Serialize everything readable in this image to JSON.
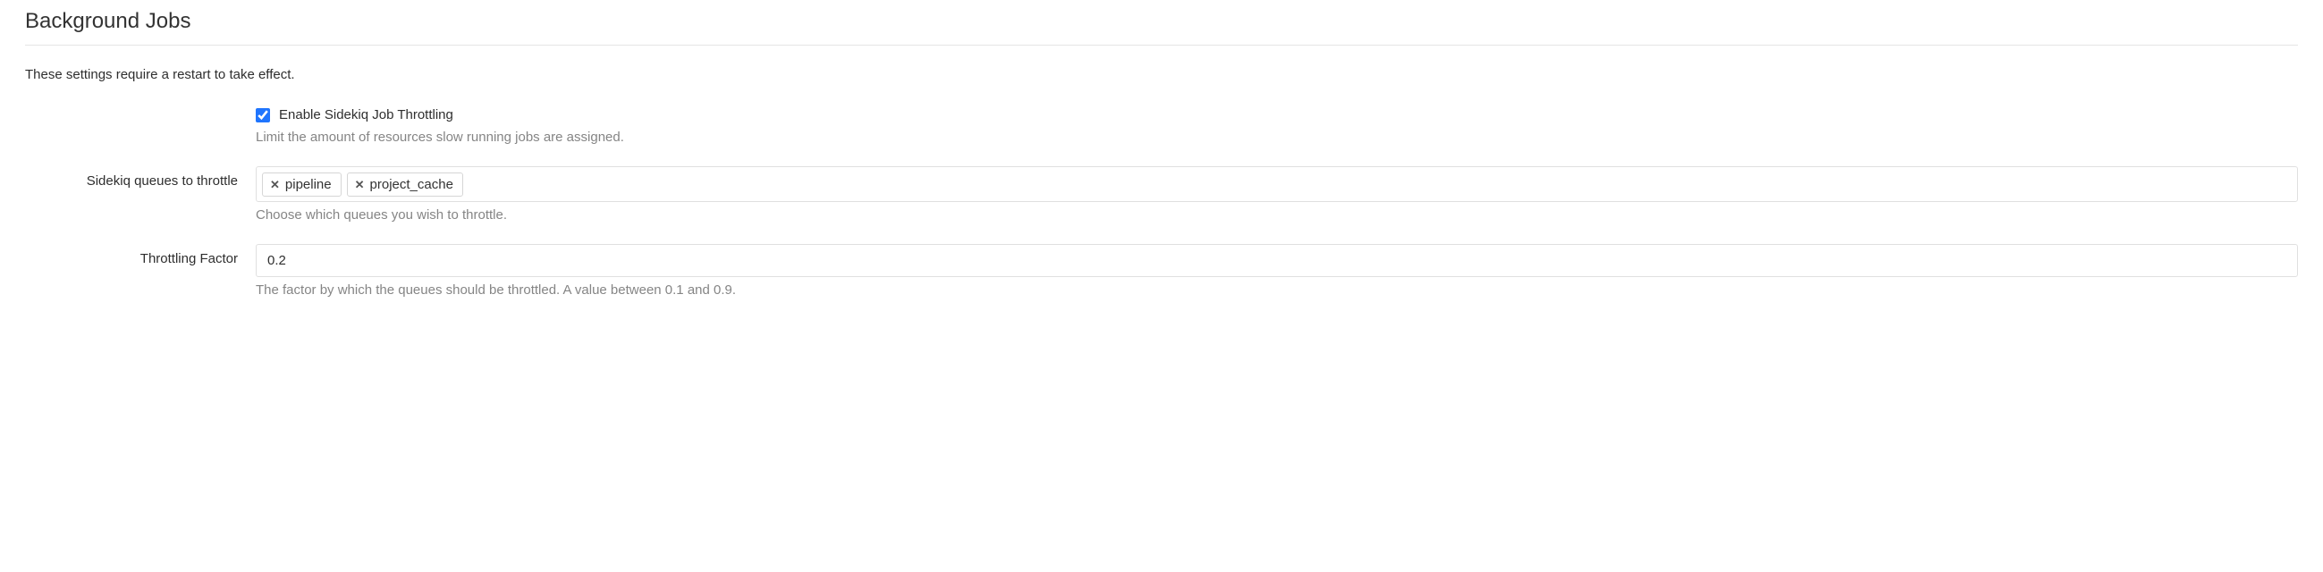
{
  "section": {
    "title": "Background Jobs",
    "intro": "These settings require a restart to take effect."
  },
  "enable": {
    "label": "Enable Sidekiq Job Throttling",
    "helper": "Limit the amount of resources slow running jobs are assigned.",
    "checked": true
  },
  "queues": {
    "label": "Sidekiq queues to throttle",
    "tags": [
      "pipeline",
      "project_cache"
    ],
    "helper": "Choose which queues you wish to throttle."
  },
  "factor": {
    "label": "Throttling Factor",
    "value": "0.2",
    "helper": "The factor by which the queues should be throttled. A value between 0.1 and 0.9."
  }
}
